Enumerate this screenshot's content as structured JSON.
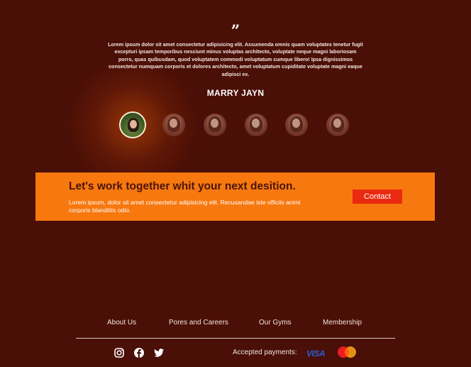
{
  "testimonial": {
    "quote_icon": "quote-icon",
    "text": "Lorem ipsum dolor sit amet consectetur adipisicing elit. Assumenda omnis quam voluptates tenetur fugit excepturi ipsam temporibus nesciunt minus voluptas architecto, voluptate neque magni laboriosam porro, quas quibusdam, quod voluptatem commodi voluptatum cumque libero! Ipsa dignissimos consectetur numquam corporis et dolores architecto, amet voluptatum cupiditate voluptate magni eaque adipisci ex.",
    "author": "MARRY JAYN",
    "avatars_count_visible": 6,
    "active_avatar_index": 0
  },
  "cta": {
    "title": "Let's work together whit your next desition.",
    "text": "Lorem ipsum, dolor sit amet consectetur adipisicing elit. Recusandae iste officiis animi corporis blanditiis odio.",
    "button_label": "Contact",
    "background": "#f7780f",
    "button_color": "#ea2a10"
  },
  "footer": {
    "nav": [
      "About Us",
      "Pores and Careers",
      "Our Gyms",
      "Membership"
    ],
    "socials": [
      "instagram-icon",
      "facebook-icon",
      "twitter-icon"
    ],
    "payments_label": "Accepted payments:",
    "payment_methods": [
      {
        "name": "VISA",
        "icon": "visa-icon"
      },
      {
        "name": "MasterCard",
        "icon": "mastercard-icon"
      }
    ]
  },
  "colors": {
    "background": "#4a0f06",
    "accent": "#f7780f"
  }
}
